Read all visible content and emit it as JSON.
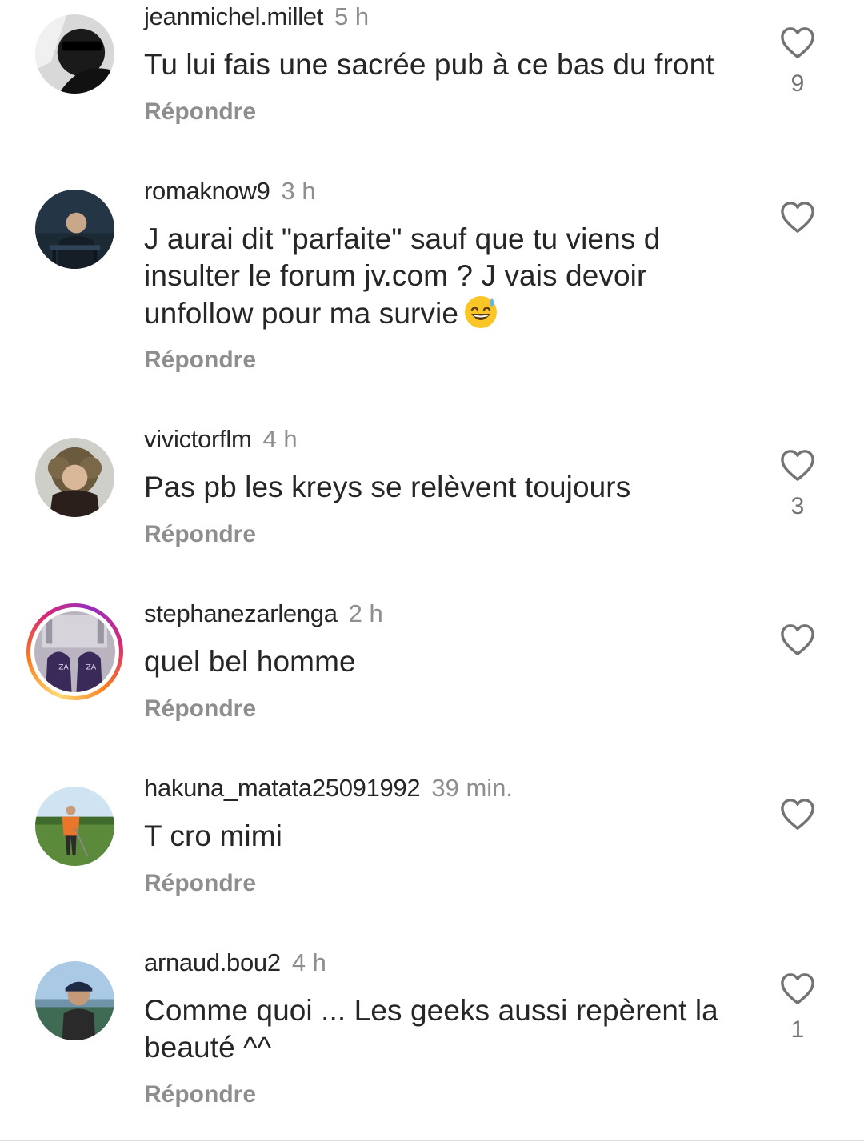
{
  "comments": [
    {
      "username": "jeanmichel.millet",
      "time": "5 h",
      "text": "Tu lui fais une sacrée pub à ce bas du front",
      "reply_label": "Répondre",
      "likes": "9"
    },
    {
      "username": "romaknow9",
      "time": "3 h",
      "text_line1": "J aurai dit \"parfaite\" sauf que tu  viens d",
      "text_line2": "insulter le forum jv.com ? J vais devoir",
      "text_line3": "unfollow pour ma survie",
      "emoji": "grinning-face-with-sweat",
      "reply_label": "Répondre",
      "likes": ""
    },
    {
      "username": "vivictorflm",
      "time": "4 h",
      "text": "Pas pb les kreys se relèvent toujours",
      "reply_label": "Répondre",
      "likes": "3"
    },
    {
      "username": "stephanezarlenga",
      "time": "2 h",
      "text": "quel bel homme",
      "reply_label": "Répondre",
      "likes": "",
      "story_ring": true
    },
    {
      "username": "hakuna_matata25091992",
      "time": "39 min.",
      "text": "T cro mimi",
      "reply_label": "Répondre",
      "likes": ""
    },
    {
      "username": "arnaud.bou2",
      "time": "4 h",
      "text": "Comme quoi ... Les geeks aussi repèrent la beauté ^^",
      "reply_label": "Répondre",
      "likes": "1"
    }
  ],
  "icons": {
    "like": "heart-outline-icon"
  },
  "colors": {
    "text": "#262626",
    "secondary": "#8e8e8e",
    "story_ring": [
      "#feda75",
      "#fa7e1e",
      "#d62976",
      "#962fbf"
    ]
  }
}
